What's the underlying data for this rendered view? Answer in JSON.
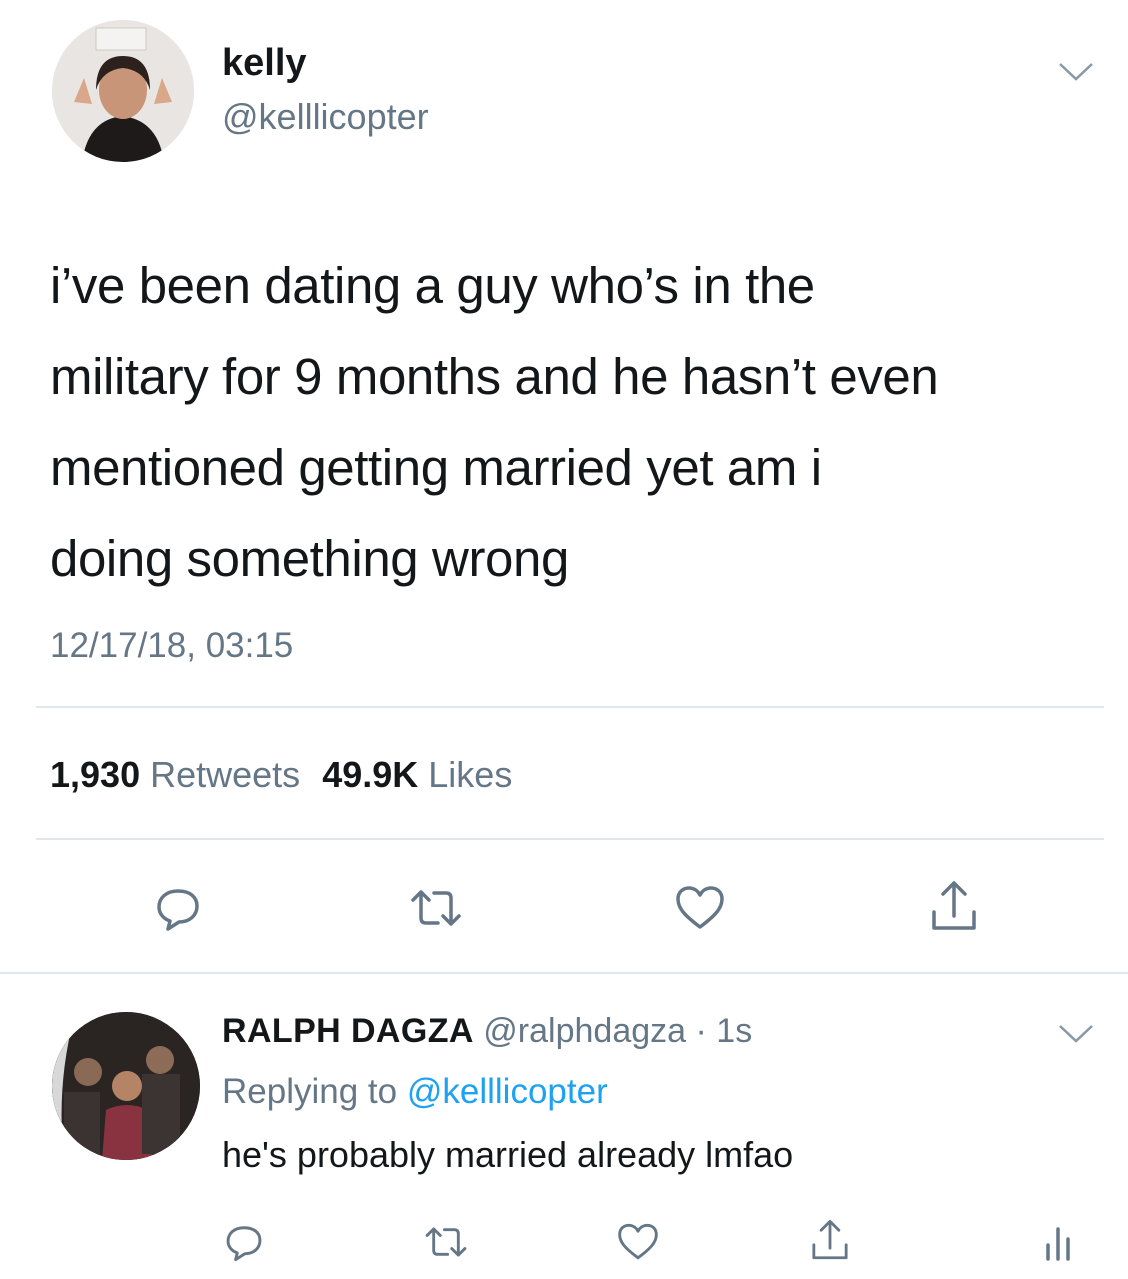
{
  "tweet": {
    "author": {
      "display_name": "kelly",
      "handle": "@kelllicopter",
      "avatar_icon": "user-photo-avatar"
    },
    "text_lines": [
      "i’ve been dating a guy who’s in the",
      "military for 9 months and he hasn’t even",
      "mentioned getting married yet am i",
      "doing something wrong"
    ],
    "timestamp": "12/17/18, 03:15",
    "stats": {
      "retweets_count": "1,930",
      "retweets_label": "Retweets",
      "likes_count": "49.9K",
      "likes_label": "Likes"
    },
    "actions": [
      "reply-icon",
      "retweet-icon",
      "like-icon",
      "share-icon"
    ]
  },
  "reply": {
    "author": {
      "display_name": "RALPH DAGZA",
      "handle": "@ralphdagza",
      "avatar_icon": "user-photo-avatar"
    },
    "separator": "·",
    "time": "1s",
    "replying_prefix": "Replying to",
    "replying_to": "@kelllicopter",
    "text": "he's probably married already lmfao",
    "actions": [
      "reply-icon",
      "retweet-icon",
      "like-icon",
      "share-icon",
      "analytics-icon"
    ]
  },
  "colors": {
    "text": "#14171a",
    "secondary": "#657786",
    "link": "#1da1f2",
    "divider": "#e1e8ed"
  }
}
